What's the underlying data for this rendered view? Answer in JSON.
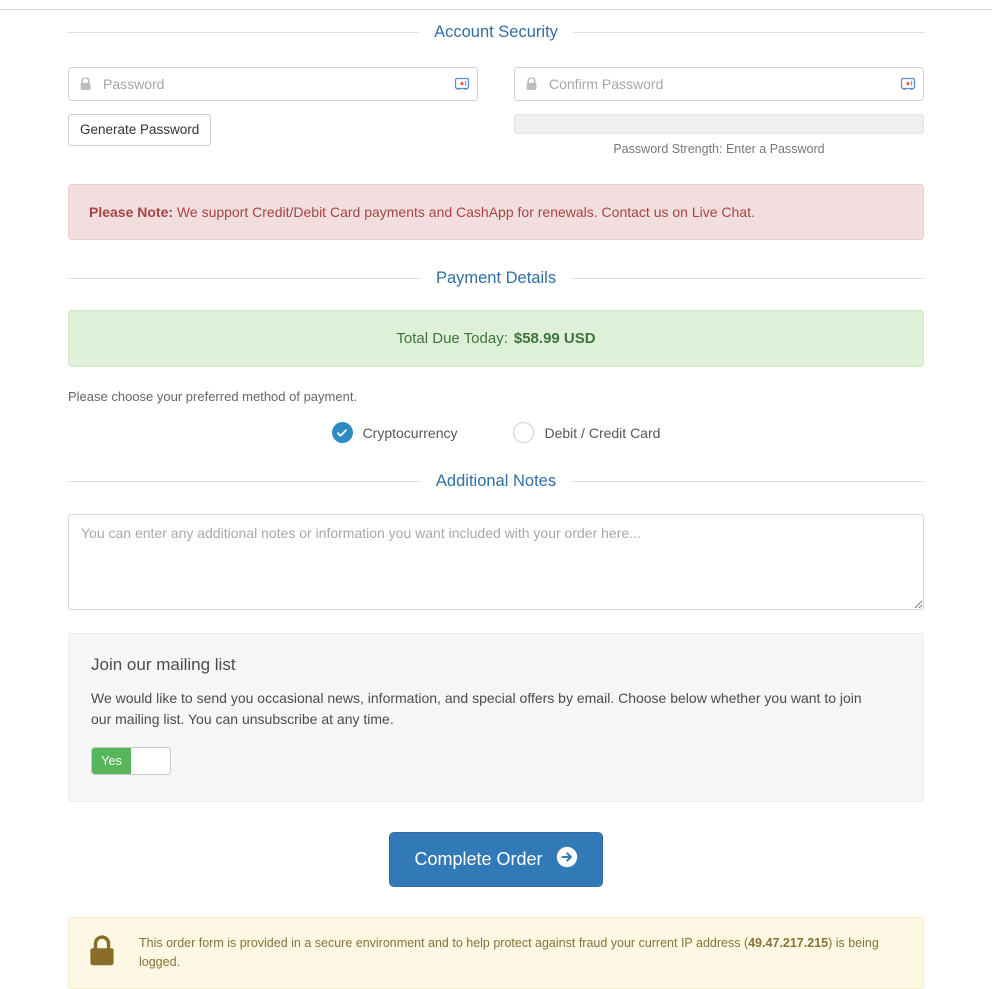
{
  "sections": {
    "account_security": "Account Security",
    "payment_details": "Payment Details",
    "additional_notes": "Additional Notes"
  },
  "password": {
    "placeholder": "Password",
    "value": "",
    "confirm_placeholder": "Confirm Password",
    "confirm_value": "",
    "generate_label": "Generate Password",
    "strength_label": "Password Strength: Enter a Password",
    "strength_percent": 0
  },
  "note_alert": {
    "strong": "Please Note:",
    "text": " We support Credit/Debit Card payments and CashApp for renewals. Contact us on Live Chat."
  },
  "payment": {
    "total_label": "Total Due Today:",
    "total_amount": "$58.99 USD",
    "choose_text": "Please choose your preferred method of payment.",
    "methods": [
      {
        "label": "Cryptocurrency",
        "selected": true
      },
      {
        "label": "Debit / Credit Card",
        "selected": false
      }
    ]
  },
  "notes": {
    "placeholder": "You can enter any additional notes or information you want included with your order here...",
    "value": ""
  },
  "mailing_list": {
    "heading": "Join our mailing list",
    "body": "We would like to send you occasional news, information, and special offers by email. Choose below whether you want to join our mailing list. You can unsubscribe at any time.",
    "toggle_label": "Yes",
    "toggle_on": true
  },
  "submit": {
    "label": "Complete Order"
  },
  "secure_notice": {
    "text_before": "This order form is provided in a secure environment and to help protect against fraud your current IP address (",
    "ip": "49.47.217.215",
    "text_after": ") is being logged."
  },
  "colors": {
    "heading": "#2f6fa5",
    "primary": "#3279b7",
    "danger_bg": "#f2dede",
    "danger_text": "#a94442",
    "success_bg": "#dff0d8",
    "success_text": "#3c763d",
    "warning_bg": "#fcf8e3",
    "warning_text": "#8a7238",
    "toggle_on": "#57b65a",
    "lock_icon": "#8a6d26"
  }
}
